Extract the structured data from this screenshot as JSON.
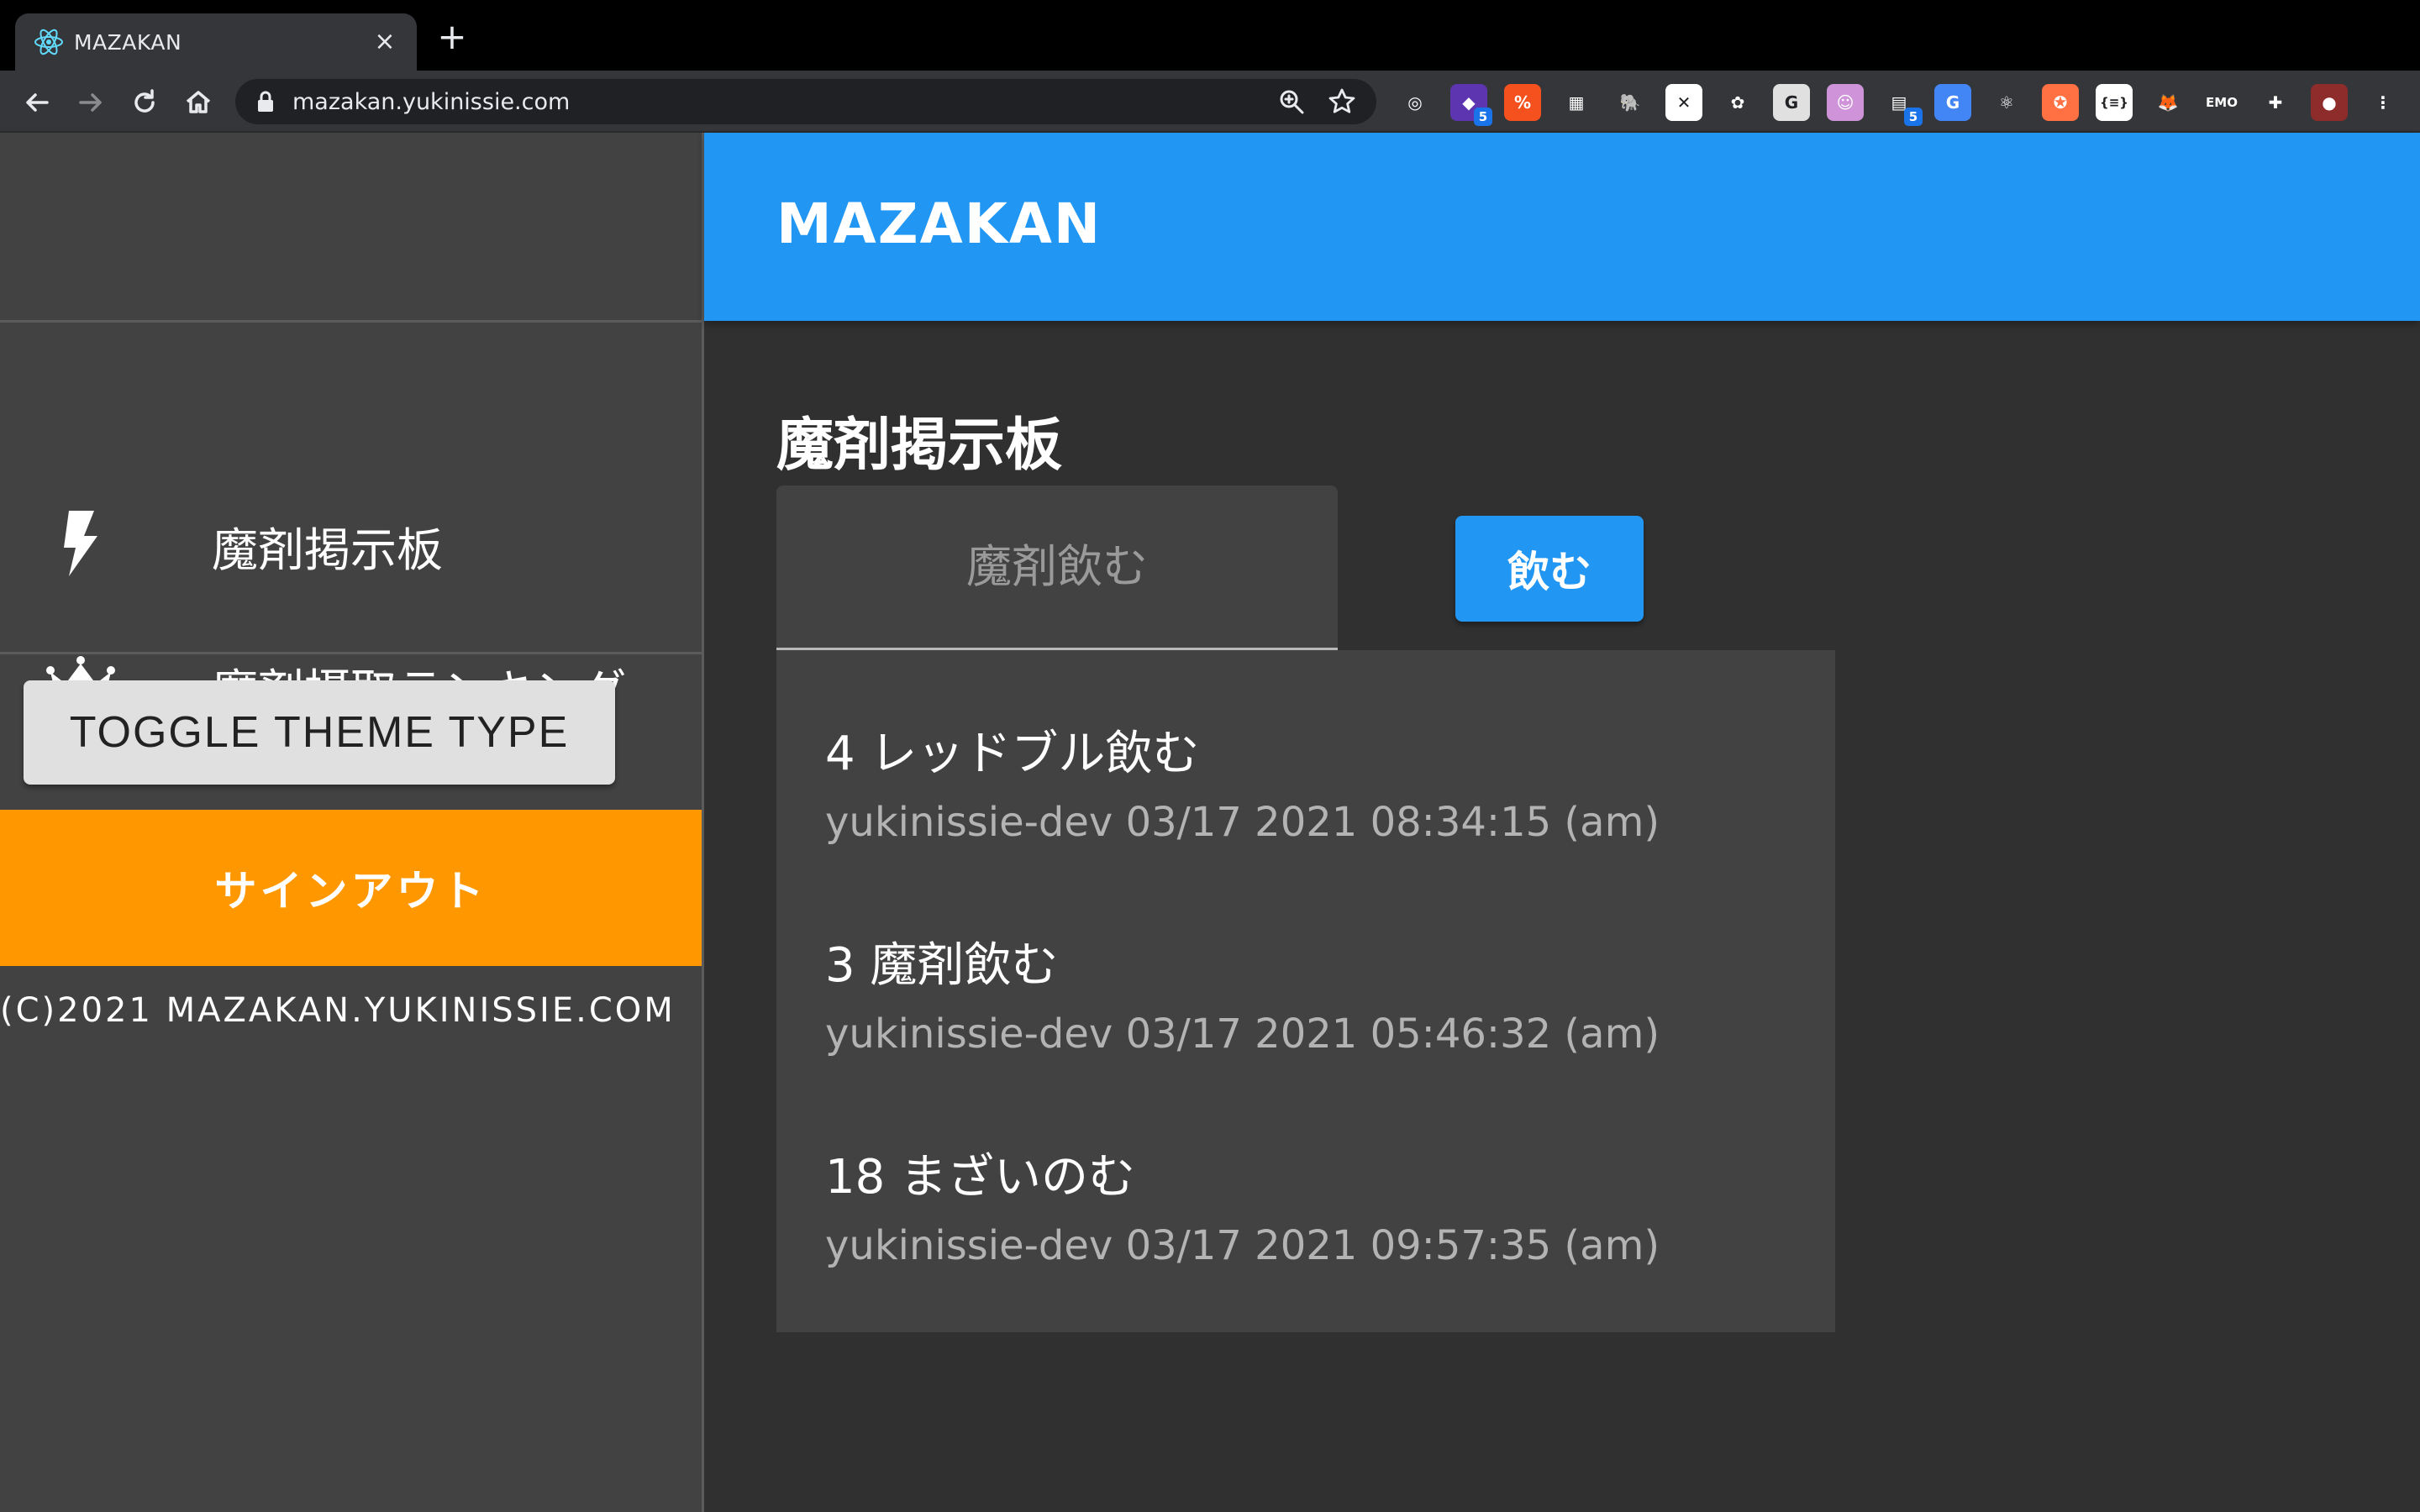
{
  "browser": {
    "tab_title": "MAZAKAN",
    "tab_close": "×",
    "new_tab": "+",
    "url": "mazakan.yukinissie.com",
    "extensions": [
      {
        "name": "cloud-extension",
        "color": "#35363a",
        "glyph": "◎",
        "badge": ""
      },
      {
        "name": "stack-extension",
        "color": "#5e35b1",
        "glyph": "◆",
        "badge": "5"
      },
      {
        "name": "orange-extension",
        "color": "#f4511e",
        "glyph": "%",
        "badge": ""
      },
      {
        "name": "qr-extension",
        "color": "#35363a",
        "glyph": "▦",
        "badge": ""
      },
      {
        "name": "evernote-extension",
        "color": "#35363a",
        "glyph": "🐘",
        "badge": ""
      },
      {
        "name": "x-extension",
        "color": "#ffffff",
        "glyph": "✕",
        "badge": ""
      },
      {
        "name": "color-extension",
        "color": "#35363a",
        "glyph": "✿",
        "badge": ""
      },
      {
        "name": "g-extension",
        "color": "#e0e0e0",
        "glyph": "G",
        "badge": ""
      },
      {
        "name": "pink-extension",
        "color": "#ce93d8",
        "glyph": "☺",
        "badge": ""
      },
      {
        "name": "tabs-extension",
        "color": "#35363a",
        "glyph": "▤",
        "badge": "5"
      },
      {
        "name": "translate-extension",
        "color": "#4285f4",
        "glyph": "G",
        "badge": ""
      },
      {
        "name": "react-extension",
        "color": "#35363a",
        "glyph": "⚛",
        "badge": ""
      },
      {
        "name": "orange-circle-extension",
        "color": "#ff7043",
        "glyph": "✪",
        "badge": ""
      },
      {
        "name": "json-extension",
        "color": "#ffffff",
        "glyph": "{≡}",
        "badge": ""
      },
      {
        "name": "metamask-extension",
        "color": "#35363a",
        "glyph": "🦊",
        "badge": ""
      },
      {
        "name": "emoji-extension",
        "color": "#35363a",
        "glyph": "EMO",
        "badge": ""
      },
      {
        "name": "puzzle-extension",
        "color": "#35363a",
        "glyph": "✚",
        "badge": ""
      },
      {
        "name": "profile-avatar",
        "color": "#8e2c2c",
        "glyph": "●",
        "badge": ""
      },
      {
        "name": "menu-extension",
        "color": "#35363a",
        "glyph": "⋮",
        "badge": ""
      }
    ]
  },
  "drawer": {
    "nav": [
      {
        "label": "魔剤掲示板",
        "icon": "bolt-icon"
      },
      {
        "label": "魔剤摂取ランキング",
        "icon": "crown-icon"
      }
    ],
    "toggle_theme_label": "TOGGLE THEME TYPE",
    "signout_label": "サインアウト",
    "copyright": "(C)2021 MAZAKAN.YUKINISSIE.COM"
  },
  "main": {
    "appbar_title": "MAZAKAN",
    "page_title": "魔剤掲示板",
    "input_placeholder": "魔剤飲む",
    "input_value": "",
    "drink_label": "飲む",
    "posts": [
      {
        "text": "4 レッドブル飲む",
        "meta": "yukinissie-dev 03/17 2021 08:34:15 (am)"
      },
      {
        "text": "3 魔剤飲む",
        "meta": "yukinissie-dev 03/17 2021 05:46:32 (am)"
      },
      {
        "text": "18 まざいのむ",
        "meta": "yukinissie-dev 03/17 2021 09:57:35 (am)"
      }
    ]
  },
  "colors": {
    "primary": "#2196f3",
    "signout": "#ff9800",
    "drawer_bg": "#424242",
    "page_bg": "#303030"
  }
}
